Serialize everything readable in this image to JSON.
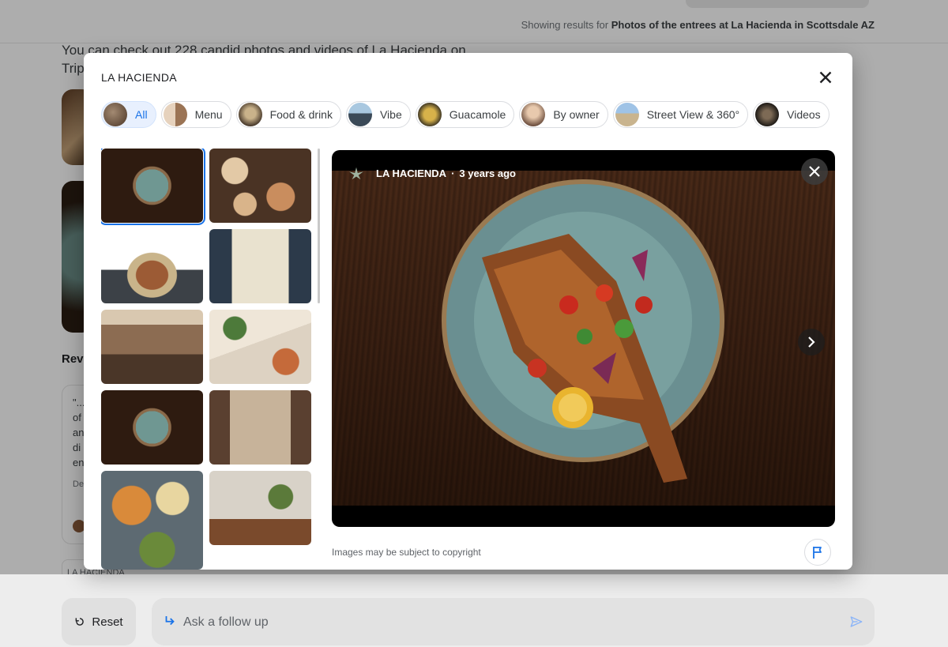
{
  "background": {
    "showing_prefix": "Showing results for ",
    "showing_query": "Photos of the entrees at La Hacienda in Scottsdale AZ",
    "intro_line1": "You can check out 228 candid photos and videos of La Hacienda on",
    "intro_line2": "Trip",
    "reviews_heading": "Rev",
    "review_lines": [
      "\"...",
      "of",
      "an",
      "di",
      "en"
    ],
    "review_date": "De",
    "chip_label": "LA HACIENDA"
  },
  "bottom": {
    "reset_label": "Reset",
    "followup_placeholder": "Ask a follow up"
  },
  "modal": {
    "title": "LA HACIENDA",
    "filters": [
      {
        "label": "All",
        "thumb_color": "#6d5644",
        "active": true
      },
      {
        "label": "Menu",
        "thumb_color": "#caa88a"
      },
      {
        "label": "Food & drink",
        "thumb_color": "#7b6a55"
      },
      {
        "label": "Vibe",
        "thumb_color": "#6d8fa8"
      },
      {
        "label": "Guacamole",
        "thumb_color": "#a58a3c"
      },
      {
        "label": "By owner",
        "thumb_color": "#8f7565"
      },
      {
        "label": "Street View & 360°",
        "thumb_color": "#7c93a3"
      },
      {
        "label": "Videos",
        "thumb_color": "#3a3530"
      }
    ],
    "viewer": {
      "source": "LA HACIENDA",
      "age": "3 years ago"
    },
    "copyright": "Images may be subject to copyright"
  },
  "colors": {
    "accent": "#1a73e8",
    "scrim": "rgba(0,0,0,0.32)"
  }
}
